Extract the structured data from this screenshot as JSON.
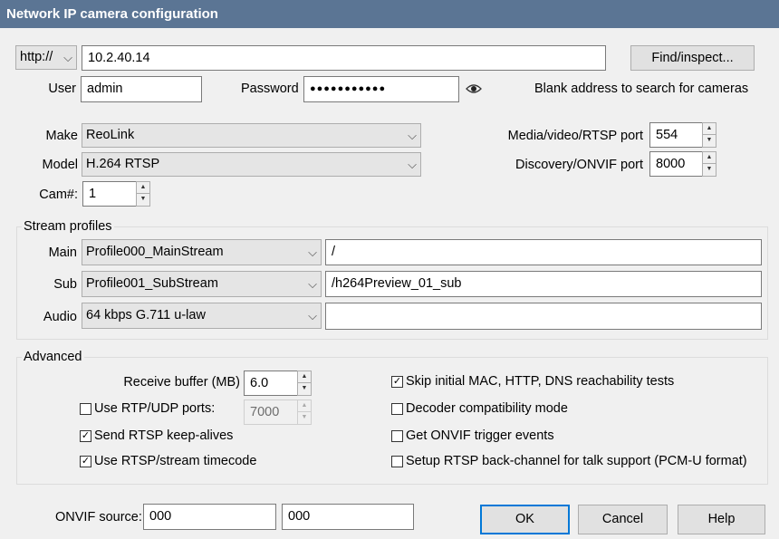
{
  "window": {
    "title": "Network IP camera configuration"
  },
  "connection": {
    "protocol": "http://",
    "address": "10.2.40.14",
    "find_button": "Find/inspect...",
    "user_label": "User",
    "user_value": "admin",
    "password_label": "Password",
    "password_value": "●●●●●●●●●●●",
    "hint": "Blank address to search for cameras"
  },
  "device": {
    "make_label": "Make",
    "make_value": "ReoLink",
    "model_label": "Model",
    "model_value": "H.264 RTSP",
    "cam_label": "Cam#:",
    "cam_value": "1",
    "media_port_label": "Media/video/RTSP port",
    "media_port_value": "554",
    "discovery_port_label": "Discovery/ONVIF port",
    "discovery_port_value": "8000"
  },
  "stream_profiles": {
    "title": "Stream profiles",
    "rows": [
      {
        "label": "Main",
        "profile": "Profile000_MainStream",
        "path": "/"
      },
      {
        "label": "Sub",
        "profile": "Profile001_SubStream",
        "path": "/h264Preview_01_sub"
      },
      {
        "label": "Audio",
        "profile": "64 kbps G.711 u-law",
        "path": ""
      }
    ]
  },
  "advanced": {
    "title": "Advanced",
    "receive_buffer_label": "Receive buffer (MB)",
    "receive_buffer_value": "6.0",
    "rtp_udp_label": "Use RTP/UDP ports:",
    "rtp_udp_checked": false,
    "rtp_udp_port": "7000",
    "keepalive_label": "Send RTSP keep-alives",
    "keepalive_checked": true,
    "timecode_label": "Use RTSP/stream timecode",
    "timecode_checked": true,
    "skip_tests_label": "Skip initial MAC, HTTP, DNS reachability tests",
    "skip_tests_checked": true,
    "decoder_compat_label": "Decoder compatibility mode",
    "decoder_compat_checked": false,
    "onvif_trigger_label": "Get ONVIF trigger events",
    "onvif_trigger_checked": false,
    "backchannel_label": "Setup RTSP back-channel for talk support (PCM-U format)",
    "backchannel_checked": false
  },
  "footer": {
    "onvif_source_label": "ONVIF source:",
    "onvif_source_1": "000",
    "onvif_source_2": "000",
    "ok": "OK",
    "cancel": "Cancel",
    "help": "Help"
  },
  "icons": {
    "check": "✓",
    "dropdown": "chevron-down-icon",
    "eye": "eye-icon"
  }
}
